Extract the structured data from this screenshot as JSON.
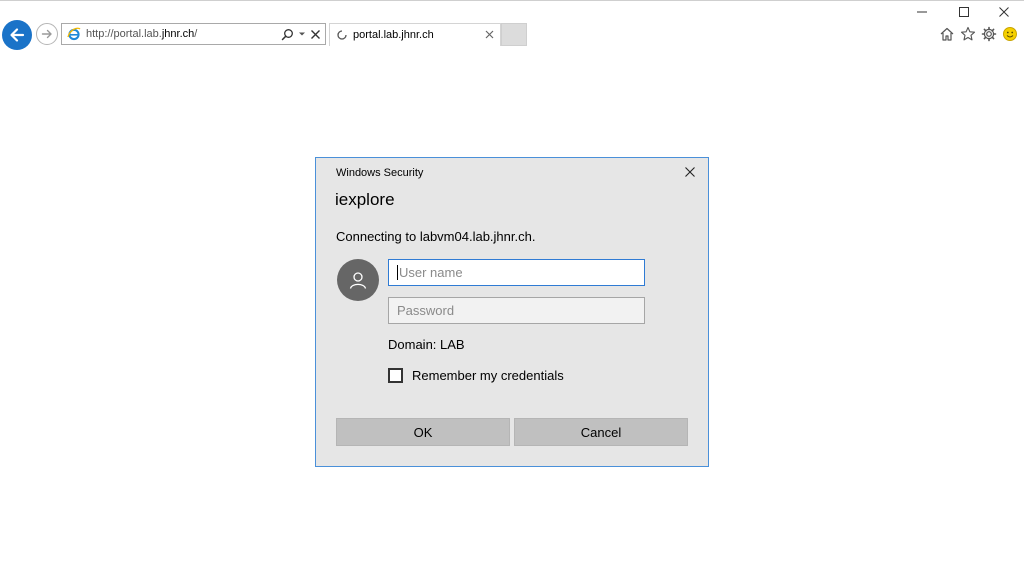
{
  "browser": {
    "address": {
      "url_prefix": "http://portal.lab.",
      "url_domain": "jhnr.ch",
      "url_suffix": "/"
    },
    "tab": {
      "title": "portal.lab.jhnr.ch"
    },
    "icons": [
      "back-arrow-icon",
      "forward-arrow-icon",
      "ie-logo-icon",
      "search-icon",
      "dropdown-icon",
      "close-icon",
      "loading-spinner-icon",
      "home-icon",
      "favorites-star-icon",
      "settings-gear-icon",
      "smiley-feedback-icon"
    ]
  },
  "dialog": {
    "caption": "Windows Security",
    "app_name": "iexplore",
    "message": "Connecting to labvm04.lab.jhnr.ch.",
    "username": {
      "value": "",
      "placeholder": "User name"
    },
    "password": {
      "value": "",
      "placeholder": "Password"
    },
    "domain": "Domain: LAB",
    "remember_label": "Remember my credentials",
    "remember_checked": false,
    "ok_label": "OK",
    "cancel_label": "Cancel"
  },
  "colors": {
    "accent": "#1a73c8",
    "dialog_bg": "#e6e6e6",
    "dialog_border": "#4a90d9",
    "button_bg": "#c0c0c0"
  }
}
